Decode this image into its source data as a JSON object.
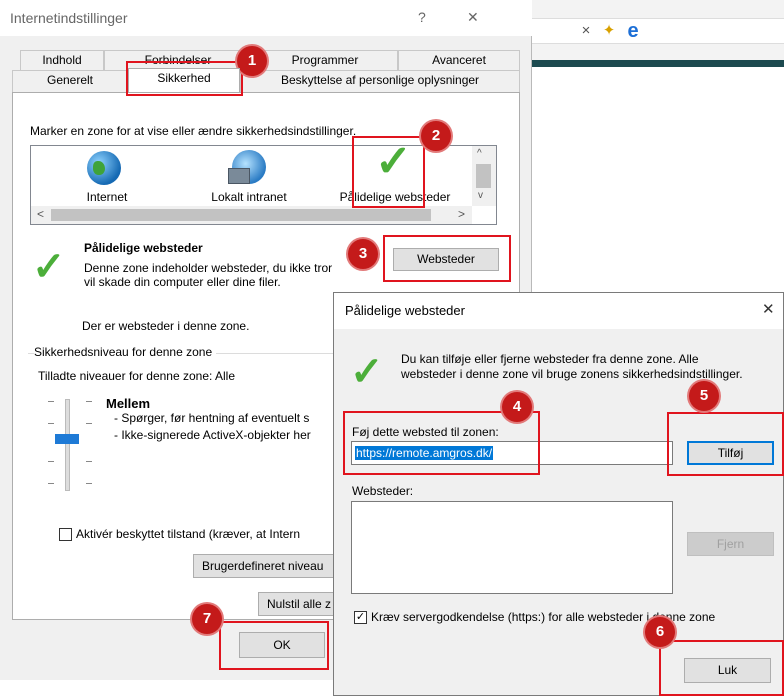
{
  "main_dialog": {
    "title": "Internetindstillinger",
    "help_glyph": "?",
    "close_glyph": "✕",
    "tabs_row1": [
      "Indhold",
      "Forbindelser",
      "Programmer",
      "Avanceret"
    ],
    "tabs_row2": [
      "Generelt",
      "Sikkerhed",
      "Beskyttelse af personlige oplysninger"
    ],
    "instruction": "Marker en zone for at vise eller ændre sikkerhedsindstillinger.",
    "zones": [
      "Internet",
      "Lokalt intranet",
      "Pålidelige websteder"
    ],
    "zone_heading": "Pålidelige websteder",
    "zone_desc_line1": "Denne zone indeholder websteder, du ikke tror",
    "zone_desc_line2": "vil skade din computer eller dine filer.",
    "websites_button": "Websteder",
    "zone_status": "Der er websteder i denne zone.",
    "security_group": "Sikkerhedsniveau for denne zone",
    "allowed_levels": "Tilladte niveauer for denne zone: Alle",
    "level_name": "Mellem",
    "level_bullet1": "- Spørger, før hentning af eventuelt s",
    "level_bullet2": "- Ikke-signerede ActiveX-objekter her",
    "protected_mode": "Aktivér beskyttet tilstand (kræver, at Intern",
    "custom_level_button": "Brugerdefineret niveau",
    "reset_all_button": "Nulstil alle z",
    "ok_button": "OK"
  },
  "trusted_dialog": {
    "title": "Pålidelige websteder",
    "close_glyph": "✕",
    "info_line1": "Du kan tilføje eller fjerne websteder fra denne zone. Alle",
    "info_line2": "websteder i denne zone vil bruge zonens sikkerhedsindstillinger.",
    "add_label": "Føj dette websted til zonen:",
    "url_value": "https://remote.amgros.dk/",
    "add_button": "Tilføj",
    "websites_label": "Websteder:",
    "remove_button": "Fjern",
    "require_https": "Kræv servergodkendelse (https:) for alle websteder i denne zone",
    "close_button": "Luk"
  },
  "browser": {
    "close_tab_glyph": "×",
    "new_tab_glyph": "✦",
    "ie_glyph": "e"
  },
  "badges": [
    "1",
    "2",
    "3",
    "4",
    "5",
    "6",
    "7"
  ],
  "colors": {
    "highlight_red": "#e0141e",
    "badge_red": "#c41a1a",
    "check_green": "#4cae3a",
    "selection_blue": "#0078d7"
  }
}
